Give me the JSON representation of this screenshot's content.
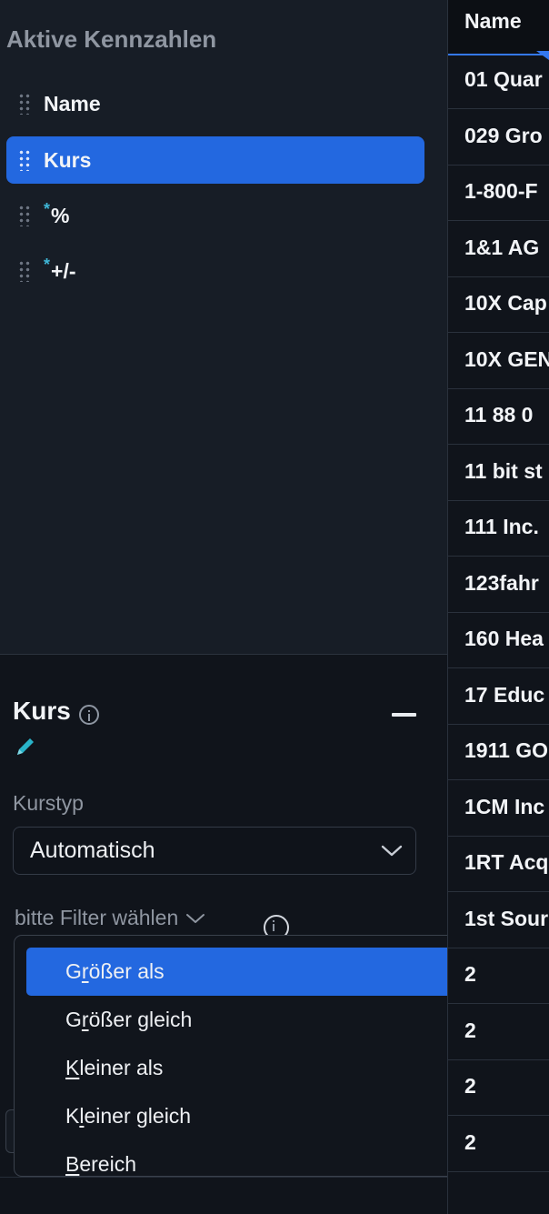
{
  "sidebar": {
    "title": "Aktive Kennzahlen",
    "items": [
      {
        "label": "Name",
        "starred": false,
        "active": false
      },
      {
        "label": "Kurs",
        "starred": false,
        "active": true
      },
      {
        "label": "%",
        "starred": true,
        "active": false
      },
      {
        "label": "+/-",
        "starred": true,
        "active": false
      }
    ],
    "star_symbol": "*"
  },
  "detail": {
    "title": "Kurs",
    "field_label": "Kurstyp",
    "select_value": "Automatisch",
    "filter_placeholder": "bitte Filter wählen"
  },
  "dropdown": {
    "items": [
      {
        "label": "Größer als",
        "mnemonic": 1,
        "active": true
      },
      {
        "label": "Größer gleich",
        "mnemonic": 1,
        "active": false
      },
      {
        "label": "Kleiner als",
        "mnemonic": 0,
        "active": false
      },
      {
        "label": "Kleiner gleich",
        "mnemonic": 1,
        "active": false
      },
      {
        "label": "Bereich",
        "mnemonic": 0,
        "active": false
      }
    ]
  },
  "table": {
    "header": "Name",
    "rows": [
      "01 Quar",
      "029 Gro",
      "1-800-F",
      "1&1 AG",
      "10X Cap",
      "10X GEN",
      "11 88 0",
      "11 bit st",
      "111 Inc.",
      "123fahr",
      "160 Hea",
      "17 Educ",
      "1911 GO",
      "1CM Inc",
      "1RT Acq",
      "1st Sour",
      "2",
      "2",
      "2",
      "2"
    ]
  },
  "colors": {
    "accent": "#2368e0",
    "star": "#3fb6d6",
    "pencil": "#29b3c9"
  }
}
